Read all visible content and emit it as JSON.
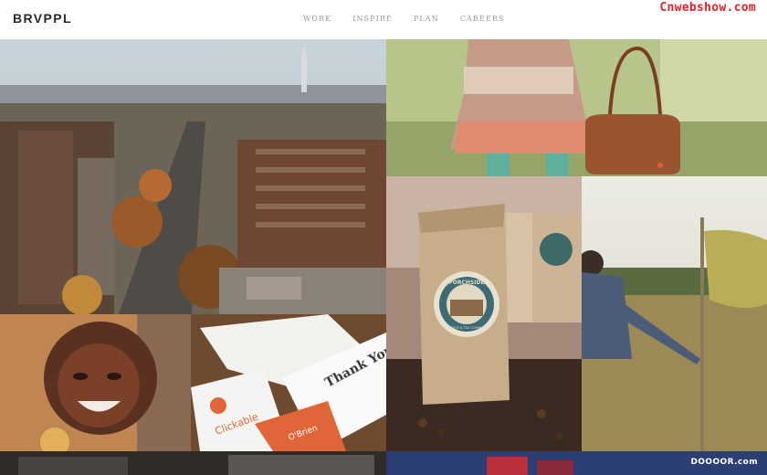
{
  "header": {
    "logo": "BRVPPL",
    "nav": [
      "WORK",
      "INSPIRE",
      "PLAN",
      "CAREERS"
    ],
    "watermark_top": "Cnwebshow.com"
  },
  "tiles": {
    "coffee_label_top": "PORCHSIDE",
    "coffee_label_bottom": "COFFEE & TEA COMPANY",
    "cards_thank_you": "Thank You",
    "cards_brand": "Clickable",
    "cards_name": "O'Brien"
  },
  "footer": {
    "watermark_bottom": "DOOOOR.com"
  },
  "colors": {
    "logo": "#2a2a2a",
    "nav": "#9a9a9a",
    "watermark_top": "#e8202a",
    "accent_orange": "#e0663a"
  }
}
